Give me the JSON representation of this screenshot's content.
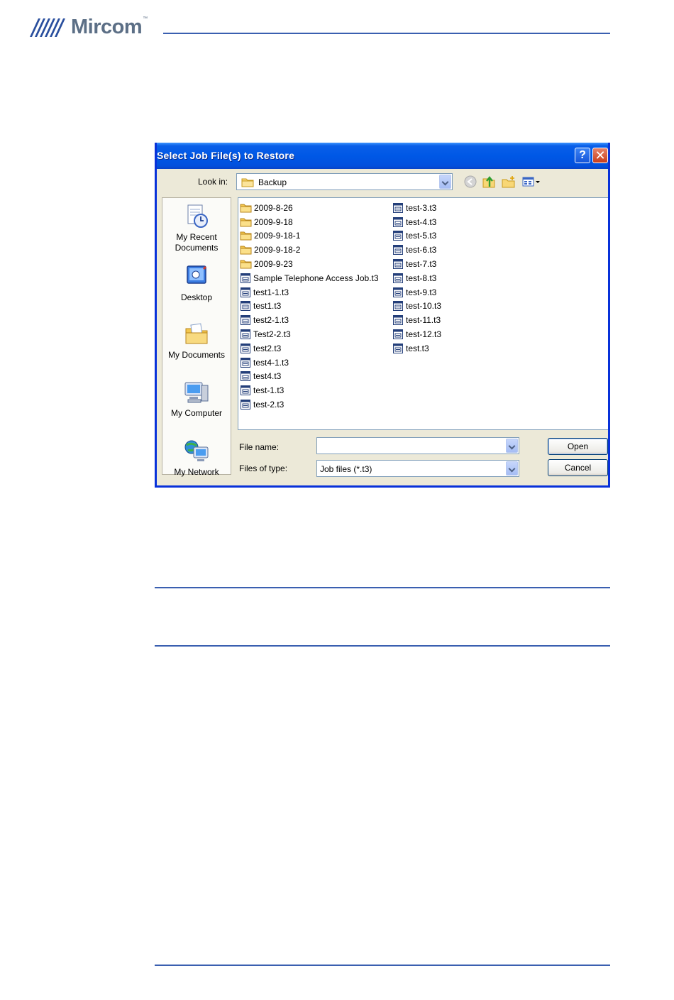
{
  "brand": {
    "name": "Mircom",
    "tm": "™"
  },
  "dialog": {
    "title": "Select Job File(s) to Restore",
    "help_label": "?",
    "close_label": "✕",
    "look_in_label": "Look in:",
    "look_in_value": "Backup",
    "toolbar": [
      "back-icon",
      "up-folder-icon",
      "new-folder-icon",
      "view-menu-icon"
    ],
    "places": [
      {
        "label": "My Recent Documents",
        "icon": "recent-documents-icon"
      },
      {
        "label": "Desktop",
        "icon": "desktop-icon"
      },
      {
        "label": "My Documents",
        "icon": "my-documents-icon"
      },
      {
        "label": "My Computer",
        "icon": "my-computer-icon"
      },
      {
        "label": "My Network",
        "icon": "my-network-icon"
      }
    ],
    "places_labels": {
      "recent_line1": "My Recent",
      "recent_line2": "Documents",
      "desktop": "Desktop",
      "documents": "My Documents",
      "computer": "My Computer",
      "network": "My Network"
    },
    "files_col1": [
      {
        "name": "2009-8-26",
        "type": "folder"
      },
      {
        "name": "2009-9-18",
        "type": "folder"
      },
      {
        "name": "2009-9-18-1",
        "type": "folder"
      },
      {
        "name": "2009-9-18-2",
        "type": "folder"
      },
      {
        "name": "2009-9-23",
        "type": "folder"
      },
      {
        "name": "Sample Telephone Access Job.t3",
        "type": "file"
      },
      {
        "name": "test1-1.t3",
        "type": "file"
      },
      {
        "name": "test1.t3",
        "type": "file"
      },
      {
        "name": "test2-1.t3",
        "type": "file"
      },
      {
        "name": "Test2-2.t3",
        "type": "file"
      },
      {
        "name": "test2.t3",
        "type": "file"
      },
      {
        "name": "test4-1.t3",
        "type": "file"
      },
      {
        "name": "test4.t3",
        "type": "file"
      },
      {
        "name": "test-1.t3",
        "type": "file"
      },
      {
        "name": "test-2.t3",
        "type": "file"
      }
    ],
    "files_col2": [
      {
        "name": "test-3.t3",
        "type": "file"
      },
      {
        "name": "test-4.t3",
        "type": "file"
      },
      {
        "name": "test-5.t3",
        "type": "file"
      },
      {
        "name": "test-6.t3",
        "type": "file"
      },
      {
        "name": "test-7.t3",
        "type": "file"
      },
      {
        "name": "test-8.t3",
        "type": "file"
      },
      {
        "name": "test-9.t3",
        "type": "file"
      },
      {
        "name": "test-10.t3",
        "type": "file"
      },
      {
        "name": "test-11.t3",
        "type": "file"
      },
      {
        "name": "test-12.t3",
        "type": "file"
      },
      {
        "name": "test.t3",
        "type": "file"
      }
    ],
    "file_name_label": "File name:",
    "file_name_value": "",
    "files_of_type_label": "Files of type:",
    "files_of_type_value": "Job files (*.t3)",
    "open_label": "Open",
    "cancel_label": "Cancel"
  },
  "colors": {
    "xp_blue": "#0058e6",
    "rule": "#3a5fb0",
    "dialog_bg": "#ece9d8",
    "brand": "#5c6f86"
  }
}
